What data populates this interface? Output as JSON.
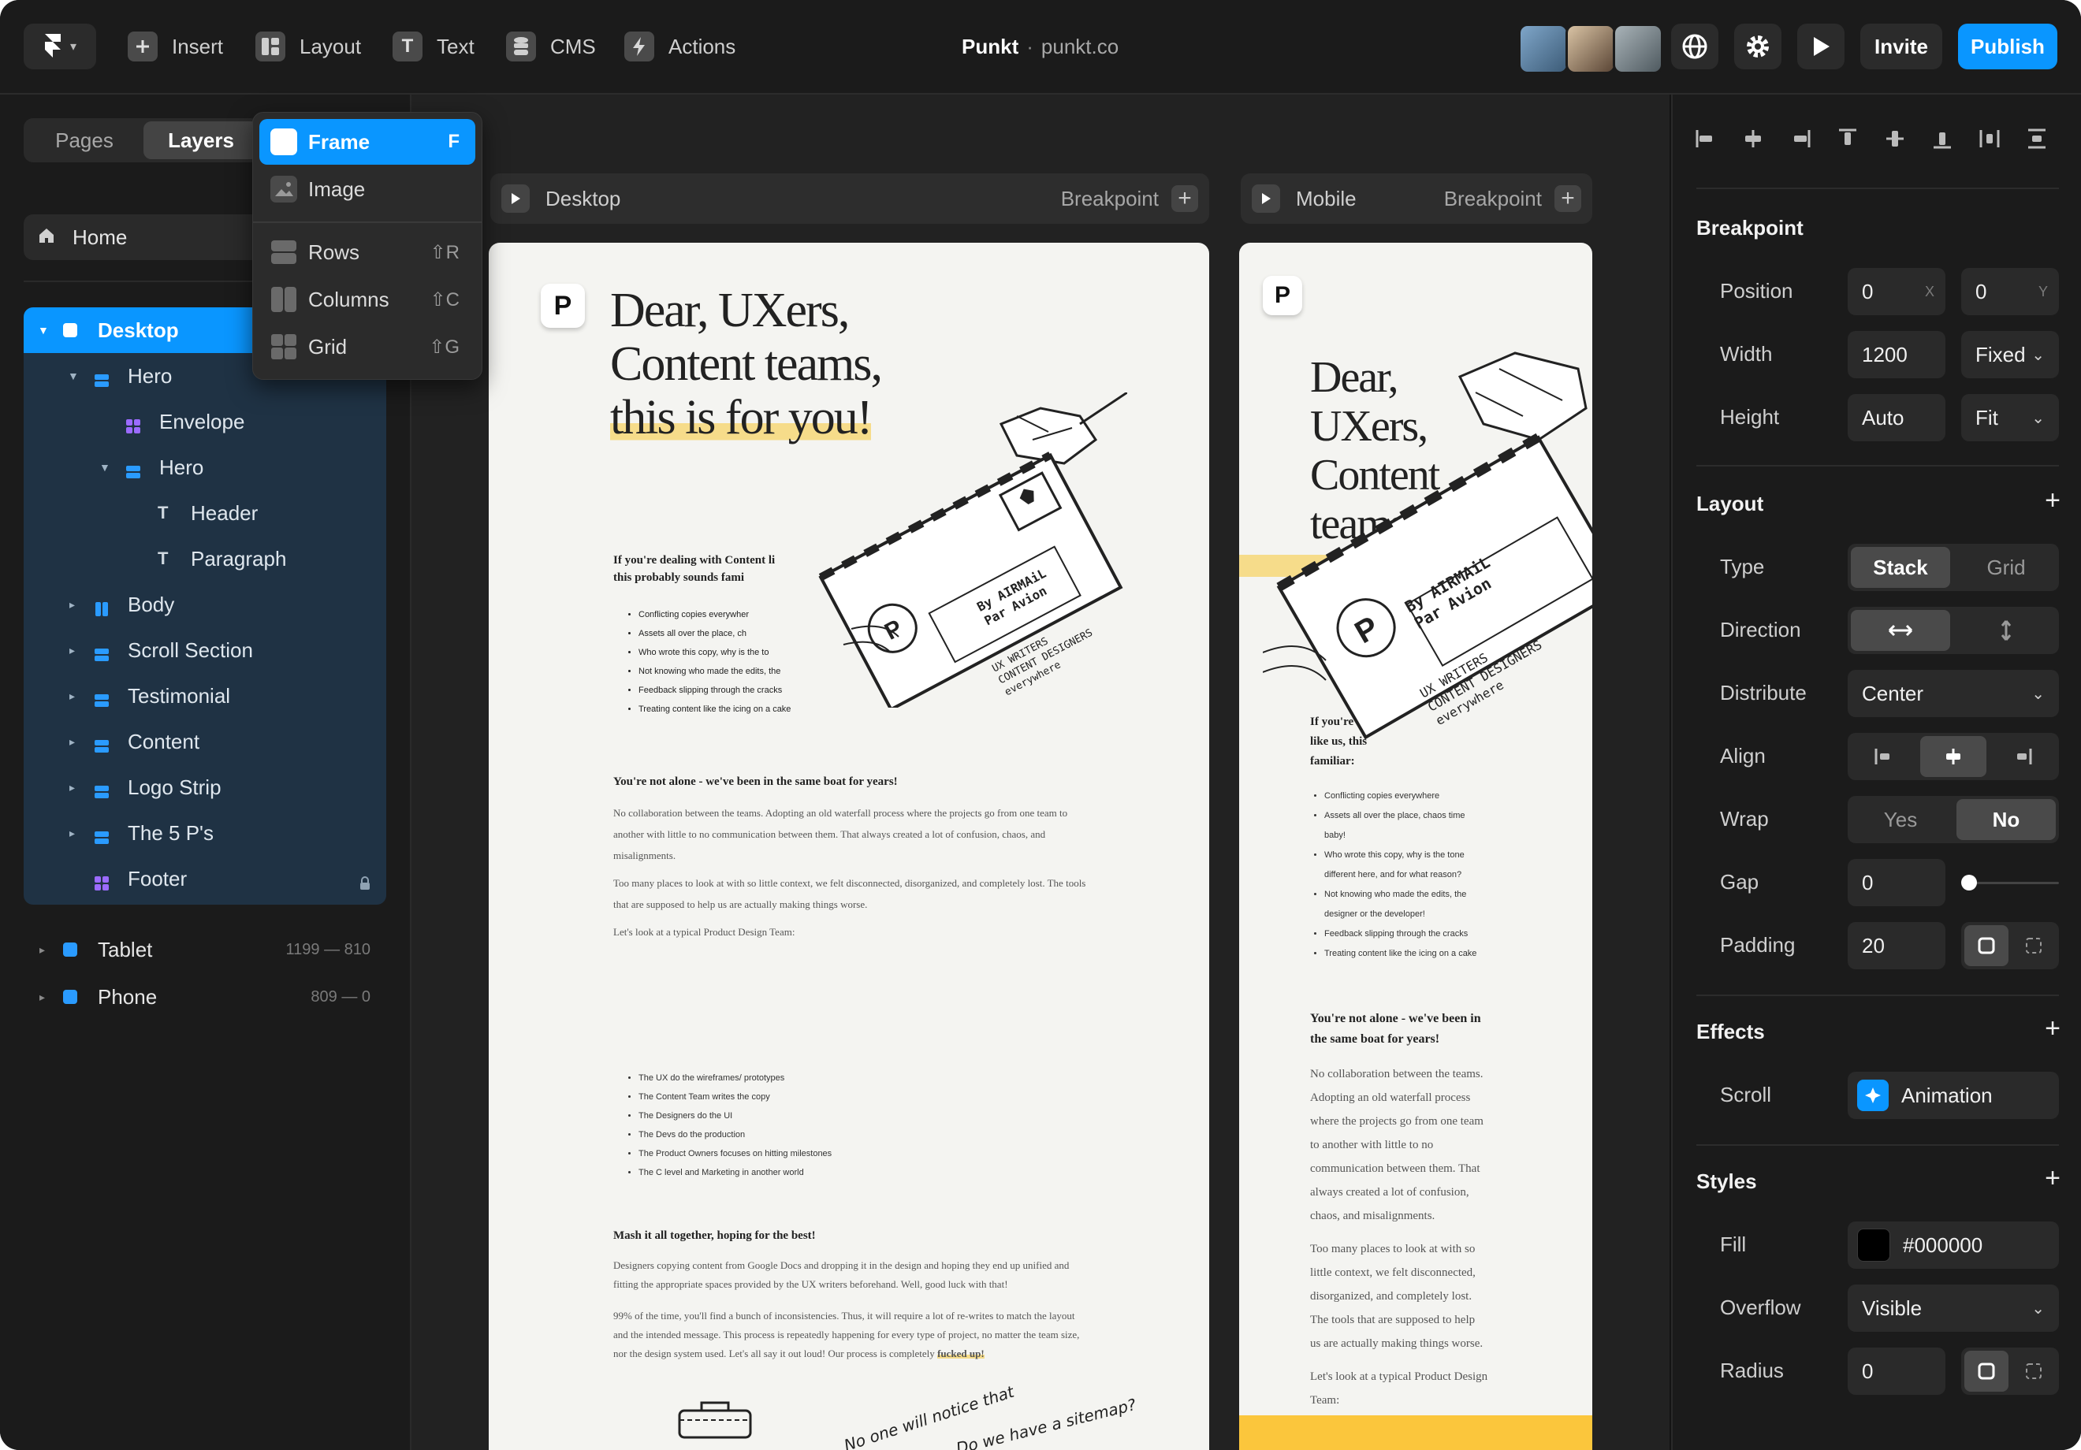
{
  "toolbar": {
    "insert": "Insert",
    "layout": "Layout",
    "text": "Text",
    "cms": "CMS",
    "actions": "Actions",
    "site_name": "Punkt",
    "site_url": "punkt.co",
    "invite": "Invite",
    "publish": "Publish",
    "accent": "#0a96ff"
  },
  "left": {
    "tabs": [
      "Pages",
      "Layers"
    ],
    "home": "Home",
    "layers": [
      {
        "label": "Desktop",
        "level": 0
      },
      {
        "label": "Hero",
        "level": 1
      },
      {
        "label": "Envelope",
        "level": 2
      },
      {
        "label": "Hero",
        "level": 2
      },
      {
        "label": "Header",
        "level": 3
      },
      {
        "label": "Paragraph",
        "level": 3
      },
      {
        "label": "Body",
        "level": 1
      },
      {
        "label": "Scroll Section",
        "level": 1
      },
      {
        "label": "Testimonial",
        "level": 1
      },
      {
        "label": "Content",
        "level": 1
      },
      {
        "label": "Logo Strip",
        "level": 1
      },
      {
        "label": "The 5 P's",
        "level": 1
      },
      {
        "label": "Footer",
        "level": 1
      }
    ],
    "tablet": {
      "label": "Tablet",
      "range": "1199 — 810"
    },
    "phone": {
      "label": "Phone",
      "range": "809 — 0"
    }
  },
  "menu": {
    "items": [
      {
        "label": "Frame",
        "shortcut": "F"
      },
      {
        "label": "Image",
        "shortcut": ""
      },
      {
        "label": "Rows",
        "shortcut": "⇧R"
      },
      {
        "label": "Columns",
        "shortcut": "⇧C"
      },
      {
        "label": "Grid",
        "shortcut": "⇧G"
      }
    ]
  },
  "canvas": {
    "desktop_label": "Desktop",
    "mobile_label": "Mobile",
    "breakpoint": "Breakpoint",
    "headline": [
      "Dear, UXers,",
      "Content teams,",
      "this is for you!"
    ],
    "mobile_headline": [
      "Dear,",
      "UXers,",
      "Content",
      "teams"
    ],
    "intro": "If you're dealing with Content like us, this probably sounds familiar:",
    "intro_desktop": [
      "If you're dealing with Content li",
      "this probably sounds fami"
    ],
    "bullets": [
      "Conflicting copies everywhere",
      "Assets all over the place, chaos time baby!",
      "Who wrote this copy, why is the tone different here, and for what reason?",
      "Not knowing who made the edits, the designer or the developer!",
      "Feedback slipping through the cracks",
      "Treating content like the icing on a cake"
    ],
    "bullets_desktop": [
      "Conflicting copies everywher",
      "Assets all over the place, ch",
      "Who wrote this copy, why is the to",
      "Not knowing who made the edits, the",
      "Feedback slipping through the cracks",
      "Treating content like the icing on a cake"
    ],
    "section2_title": "You're not alone - we've been in the same boat for years!",
    "section2_p1": "No collaboration between the teams. Adopting an old waterfall process where the projects go from one team to another with little to no communication between them. That always created a lot of confusion, chaos, and misalignments.",
    "section2_p2": "Too many places to look at with so little context, we felt disconnected, disorganized, and completely lost. The tools that are supposed to help us are actually making things worse.",
    "section2_p3": "Let's look at a typical Product Design Team:",
    "team_bullets": [
      "The UX do the wireframes/ prototypes",
      "The Content Team writes the copy",
      "The Designers do the UI",
      "The Devs do the production",
      "The Product Owners focuses on hitting milestones",
      "The C level and Marketing in another world"
    ],
    "section3_title": "Mash it all together, hoping for the best!",
    "section3_p1": "Designers copying content from Google Docs and dropping it in the design and hoping they end up unified and fitting the appropriate spaces provided by the UX writers beforehand. Well, good luck with that!",
    "section3_p2": "99% of the time, you'll find a bunch of inconsistencies. Thus, it will require a lot of re-writes to match the layout and the intended message. This process is repeatedly happening for every type of project, no matter the team size, nor the design system used. Let's all say it out loud! Our process is completely",
    "section3_emph": "fucked up!",
    "scribble1": "No one will notice that",
    "scribble2": "Do we have a sitemap?",
    "envelope_lines": [
      "By AIRMAiL",
      "Par Avion",
      "UX WRITERS",
      "CONTENT DESIGNERS",
      "everywhere"
    ],
    "mobile_intro": [
      "If you're",
      "like us, this",
      "familiar:"
    ],
    "mobile_section2_title": [
      "You're not alone - we've been in",
      "the same boat for years!"
    ],
    "mobile_section2_p1": [
      "No collaboration between the teams.",
      "Adopting an old waterfall process",
      "where the projects go from one team",
      "to another with little to no",
      "communication between them. That",
      "always created a lot of confusion,",
      "chaos, and misalignments."
    ],
    "mobile_section2_p2": [
      "Too many places to look at with so",
      "little context, we felt disconnected,",
      "disorganized, and completely lost.",
      "The tools that are supposed to help",
      "us are actually making things worse."
    ],
    "mobile_section2_p3": [
      "Let's look at a typical Product Design",
      "Team:"
    ],
    "mobile_bullets": [
      [
        "Conflicting copies everywhere"
      ],
      [
        "Assets all over the place, chaos time",
        "baby!"
      ],
      [
        "Who wrote this copy, why is the tone",
        "different here, and for what reason?"
      ],
      [
        "Not knowing who made the edits, the",
        "designer or the developer!"
      ],
      [
        "Feedback slipping through the cracks"
      ],
      [
        "Treating content like the icing on a cake"
      ]
    ]
  },
  "right": {
    "breakpoint_title": "Breakpoint",
    "position_label": "Position",
    "pos_x": "0",
    "pos_x_axis": "X",
    "pos_y": "0",
    "pos_y_axis": "Y",
    "width_label": "Width",
    "width_value": "1200",
    "width_mode": "Fixed",
    "height_label": "Height",
    "height_value": "Auto",
    "height_mode": "Fit",
    "layout_title": "Layout",
    "type_label": "Type",
    "type_options": [
      "Stack",
      "Grid"
    ],
    "direction_label": "Direction",
    "distribute_label": "Distribute",
    "distribute_value": "Center",
    "align_label": "Align",
    "wrap_label": "Wrap",
    "wrap_options": [
      "Yes",
      "No"
    ],
    "gap_label": "Gap",
    "gap_value": "0",
    "padding_label": "Padding",
    "padding_value": "20",
    "effects_title": "Effects",
    "scroll_label": "Scroll",
    "scroll_value": "Animation",
    "styles_title": "Styles",
    "fill_label": "Fill",
    "fill_value": "#000000",
    "overflow_label": "Overflow",
    "overflow_value": "Visible",
    "radius_label": "Radius",
    "radius_value": "0"
  }
}
